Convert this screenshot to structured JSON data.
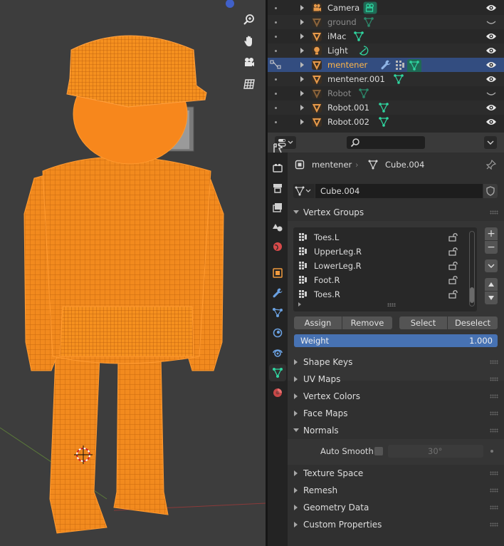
{
  "colors": {
    "accent": "#4772b3",
    "selected_row": "#334d80",
    "active_object": "#ffb64a",
    "mesh_orange": "#ff8c1a",
    "data_green": "#2fd6a0"
  },
  "viewport": {
    "nav_tools": [
      {
        "icon": "zoom-icon"
      },
      {
        "icon": "hand-pan-icon"
      },
      {
        "icon": "camera-view-icon"
      },
      {
        "icon": "ortho-grid-icon"
      }
    ]
  },
  "outliner": {
    "rows": [
      {
        "name": "Camera",
        "type": "camera",
        "state": "normal",
        "visible": true,
        "extra": "camera-data-icon"
      },
      {
        "name": "ground",
        "type": "mesh",
        "state": "dim",
        "visible": false,
        "extra": "mesh-data-icon"
      },
      {
        "name": "iMac",
        "type": "mesh",
        "state": "normal",
        "visible": true,
        "extra": "mesh-data-icon"
      },
      {
        "name": "Light",
        "type": "light",
        "state": "normal",
        "visible": true,
        "extra": "light-data-icon"
      },
      {
        "name": "mentener",
        "type": "mesh",
        "state": "active",
        "visible": true,
        "extra": "modifiers-vgroups-mesh"
      },
      {
        "name": "mentener.001",
        "type": "mesh",
        "state": "normal",
        "visible": true,
        "extra": "mesh-data-icon"
      },
      {
        "name": "Robot",
        "type": "mesh",
        "state": "dim",
        "visible": false,
        "extra": "mesh-data-icon"
      },
      {
        "name": "Robot.001",
        "type": "mesh",
        "state": "normal",
        "visible": true,
        "extra": "mesh-data-icon"
      },
      {
        "name": "Robot.002",
        "type": "mesh",
        "state": "normal",
        "visible": true,
        "extra": "mesh-data-icon"
      }
    ]
  },
  "properties": {
    "search_placeholder": "",
    "breadcrumb": {
      "object": "mentener",
      "data": "Cube.004"
    },
    "mesh_name": "Cube.004",
    "tabs": [
      "tool-icon",
      "render-icon",
      "output-icon",
      "view-layer-icon",
      "scene-icon",
      "world-icon",
      "object-icon",
      "modifier-icon",
      "particles-icon",
      "physics-icon",
      "constraints-icon",
      "mesh-data-icon",
      "material-icon"
    ],
    "active_tab": "mesh-data-icon",
    "vertex_groups": {
      "title": "Vertex Groups",
      "items": [
        "Toes.L",
        "UpperLeg.R",
        "LowerLeg.R",
        "Foot.R",
        "Toes.R"
      ],
      "assign": "Assign",
      "remove": "Remove",
      "select": "Select",
      "deselect": "Deselect",
      "weight_label": "Weight",
      "weight_value": "1.000"
    },
    "panels": {
      "shape_keys": "Shape Keys",
      "uv_maps": "UV Maps",
      "vertex_colors": "Vertex Colors",
      "face_maps": "Face Maps",
      "normals": "Normals",
      "texture_space": "Texture Space",
      "remesh": "Remesh",
      "geometry_data": "Geometry Data",
      "custom_properties": "Custom Properties"
    },
    "normals": {
      "auto_smooth_label": "Auto Smooth",
      "auto_smooth_checked": false,
      "angle": "30°"
    }
  }
}
